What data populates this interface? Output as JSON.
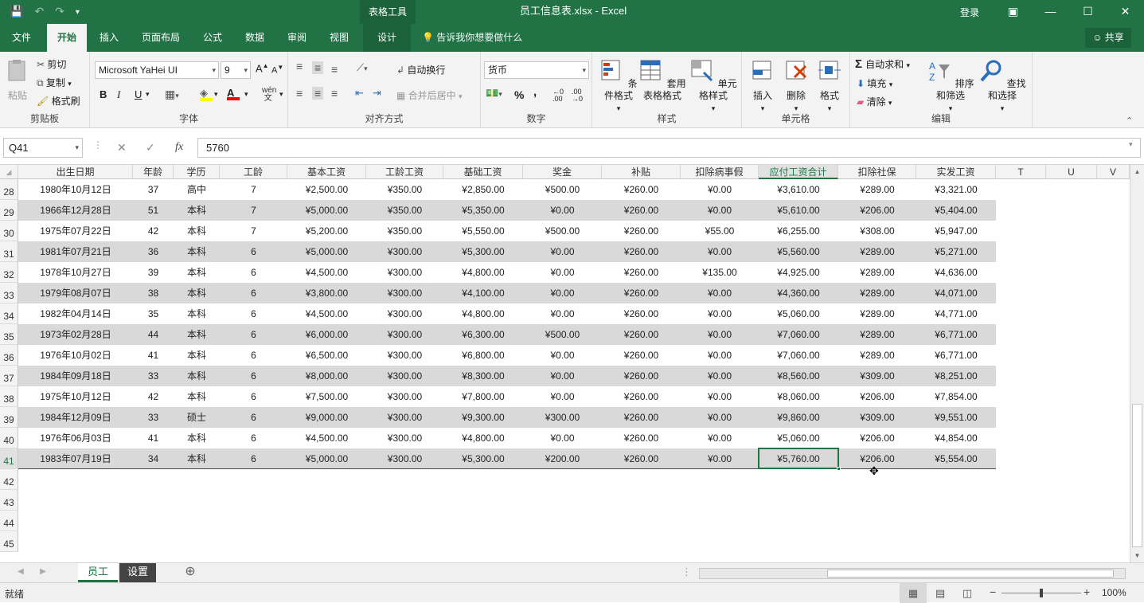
{
  "titlebar": {
    "tool_title": "表格工具",
    "doc_title": "员工信息表.xlsx  -  Excel",
    "login": "登录"
  },
  "tabs": [
    "文件",
    "开始",
    "插入",
    "页面布局",
    "公式",
    "数据",
    "审阅",
    "视图",
    "设计"
  ],
  "tell_me": "告诉我你想要做什么",
  "share": "共享",
  "ribbon": {
    "clipboard": {
      "paste": "粘贴",
      "cut": "剪切",
      "copy": "复制",
      "format_painter": "格式刷",
      "label": "剪贴板"
    },
    "font": {
      "name": "Microsoft YaHei UI",
      "size": "9",
      "bold": "B",
      "italic": "I",
      "underline": "U",
      "label": "字体"
    },
    "alignment": {
      "wrap": "自动换行",
      "merge": "合并后居中",
      "label": "对齐方式"
    },
    "number": {
      "format": "货币",
      "percent": "%",
      "comma": ",",
      "label": "数字"
    },
    "styles": {
      "conditional": "条件格式",
      "table": "套用\n表格格式",
      "cell_styles": "单元格样式",
      "label": "样式"
    },
    "cells": {
      "insert": "插入",
      "delete": "删除",
      "format": "格式",
      "label": "单元格"
    },
    "editing": {
      "autosum": "自动求和",
      "fill": "填充",
      "clear": "清除",
      "sort": "排序和筛选",
      "find": "查找和选择",
      "label": "编辑"
    }
  },
  "formula_bar": {
    "name_box": "Q41",
    "content": "5760"
  },
  "columns": [
    "出生日期",
    "年龄",
    "学历",
    "工龄",
    "基本工资",
    "工龄工资",
    "基础工资",
    "奖金",
    "补贴",
    "扣除病事假",
    "应付工资合计",
    "扣除社保",
    "实发工资",
    "T",
    "U",
    "V"
  ],
  "rows": [
    {
      "num": "28",
      "cells": [
        "1980年10月12日",
        "37",
        "高中",
        "7",
        "¥2,500.00",
        "¥350.00",
        "¥2,850.00",
        "¥500.00",
        "¥260.00",
        "¥0.00",
        "¥3,610.00",
        "¥289.00",
        "¥3,321.00"
      ]
    },
    {
      "num": "29",
      "cells": [
        "1966年12月28日",
        "51",
        "本科",
        "7",
        "¥5,000.00",
        "¥350.00",
        "¥5,350.00",
        "¥0.00",
        "¥260.00",
        "¥0.00",
        "¥5,610.00",
        "¥206.00",
        "¥5,404.00"
      ]
    },
    {
      "num": "30",
      "cells": [
        "1975年07月22日",
        "42",
        "本科",
        "7",
        "¥5,200.00",
        "¥350.00",
        "¥5,550.00",
        "¥500.00",
        "¥260.00",
        "¥55.00",
        "¥6,255.00",
        "¥308.00",
        "¥5,947.00"
      ]
    },
    {
      "num": "31",
      "cells": [
        "1981年07月21日",
        "36",
        "本科",
        "6",
        "¥5,000.00",
        "¥300.00",
        "¥5,300.00",
        "¥0.00",
        "¥260.00",
        "¥0.00",
        "¥5,560.00",
        "¥289.00",
        "¥5,271.00"
      ]
    },
    {
      "num": "32",
      "cells": [
        "1978年10月27日",
        "39",
        "本科",
        "6",
        "¥4,500.00",
        "¥300.00",
        "¥4,800.00",
        "¥0.00",
        "¥260.00",
        "¥135.00",
        "¥4,925.00",
        "¥289.00",
        "¥4,636.00"
      ]
    },
    {
      "num": "33",
      "cells": [
        "1979年08月07日",
        "38",
        "本科",
        "6",
        "¥3,800.00",
        "¥300.00",
        "¥4,100.00",
        "¥0.00",
        "¥260.00",
        "¥0.00",
        "¥4,360.00",
        "¥289.00",
        "¥4,071.00"
      ]
    },
    {
      "num": "34",
      "cells": [
        "1982年04月14日",
        "35",
        "本科",
        "6",
        "¥4,500.00",
        "¥300.00",
        "¥4,800.00",
        "¥0.00",
        "¥260.00",
        "¥0.00",
        "¥5,060.00",
        "¥289.00",
        "¥4,771.00"
      ]
    },
    {
      "num": "35",
      "cells": [
        "1973年02月28日",
        "44",
        "本科",
        "6",
        "¥6,000.00",
        "¥300.00",
        "¥6,300.00",
        "¥500.00",
        "¥260.00",
        "¥0.00",
        "¥7,060.00",
        "¥289.00",
        "¥6,771.00"
      ]
    },
    {
      "num": "36",
      "cells": [
        "1976年10月02日",
        "41",
        "本科",
        "6",
        "¥6,500.00",
        "¥300.00",
        "¥6,800.00",
        "¥0.00",
        "¥260.00",
        "¥0.00",
        "¥7,060.00",
        "¥289.00",
        "¥6,771.00"
      ]
    },
    {
      "num": "37",
      "cells": [
        "1984年09月18日",
        "33",
        "本科",
        "6",
        "¥8,000.00",
        "¥300.00",
        "¥8,300.00",
        "¥0.00",
        "¥260.00",
        "¥0.00",
        "¥8,560.00",
        "¥309.00",
        "¥8,251.00"
      ]
    },
    {
      "num": "38",
      "cells": [
        "1975年10月12日",
        "42",
        "本科",
        "6",
        "¥7,500.00",
        "¥300.00",
        "¥7,800.00",
        "¥0.00",
        "¥260.00",
        "¥0.00",
        "¥8,060.00",
        "¥206.00",
        "¥7,854.00"
      ]
    },
    {
      "num": "39",
      "cells": [
        "1984年12月09日",
        "33",
        "硕士",
        "6",
        "¥9,000.00",
        "¥300.00",
        "¥9,300.00",
        "¥300.00",
        "¥260.00",
        "¥0.00",
        "¥9,860.00",
        "¥309.00",
        "¥9,551.00"
      ]
    },
    {
      "num": "40",
      "cells": [
        "1976年06月03日",
        "41",
        "本科",
        "6",
        "¥4,500.00",
        "¥300.00",
        "¥4,800.00",
        "¥0.00",
        "¥260.00",
        "¥0.00",
        "¥5,060.00",
        "¥206.00",
        "¥4,854.00"
      ]
    },
    {
      "num": "41",
      "cells": [
        "1983年07月19日",
        "34",
        "本科",
        "6",
        "¥5,000.00",
        "¥300.00",
        "¥5,300.00",
        "¥200.00",
        "¥260.00",
        "¥0.00",
        "¥5,760.00",
        "¥206.00",
        "¥5,554.00"
      ]
    },
    {
      "num": "42",
      "cells": []
    },
    {
      "num": "43",
      "cells": []
    },
    {
      "num": "44",
      "cells": []
    },
    {
      "num": "45",
      "cells": []
    }
  ],
  "sheets": [
    "员工",
    "设置"
  ],
  "status": {
    "ready": "就绪",
    "zoom": "100%"
  }
}
